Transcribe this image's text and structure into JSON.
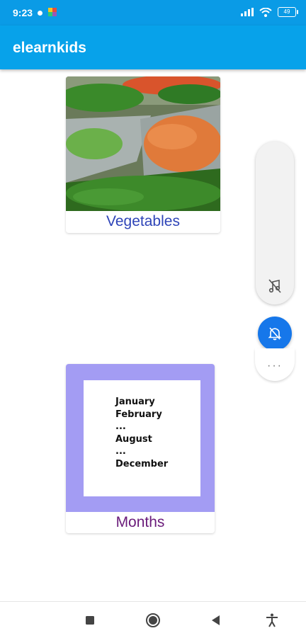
{
  "status_bar": {
    "time": "9:23",
    "battery": "49"
  },
  "app_bar": {
    "title": "elearnkids"
  },
  "categories": [
    {
      "label": "Vegetables",
      "image": "vegetables-market-photo",
      "label_color": "#2f45b8"
    },
    {
      "label": "Months",
      "image_text": "January\nFebruary\n...\nAugust\n...\nDecember",
      "image_background": "#a39cf3",
      "label_color": "#6a1b7a"
    }
  ],
  "side_controls": {
    "music_off_icon": "music-off-icon",
    "notification_off_icon": "notifications-off-icon",
    "more_label": "···"
  },
  "nav": {
    "icons": [
      "recent-apps-icon",
      "home-icon",
      "back-icon",
      "accessibility-icon"
    ]
  },
  "colors": {
    "app_bar": "#07a2ea",
    "fab": "#1677ea"
  }
}
